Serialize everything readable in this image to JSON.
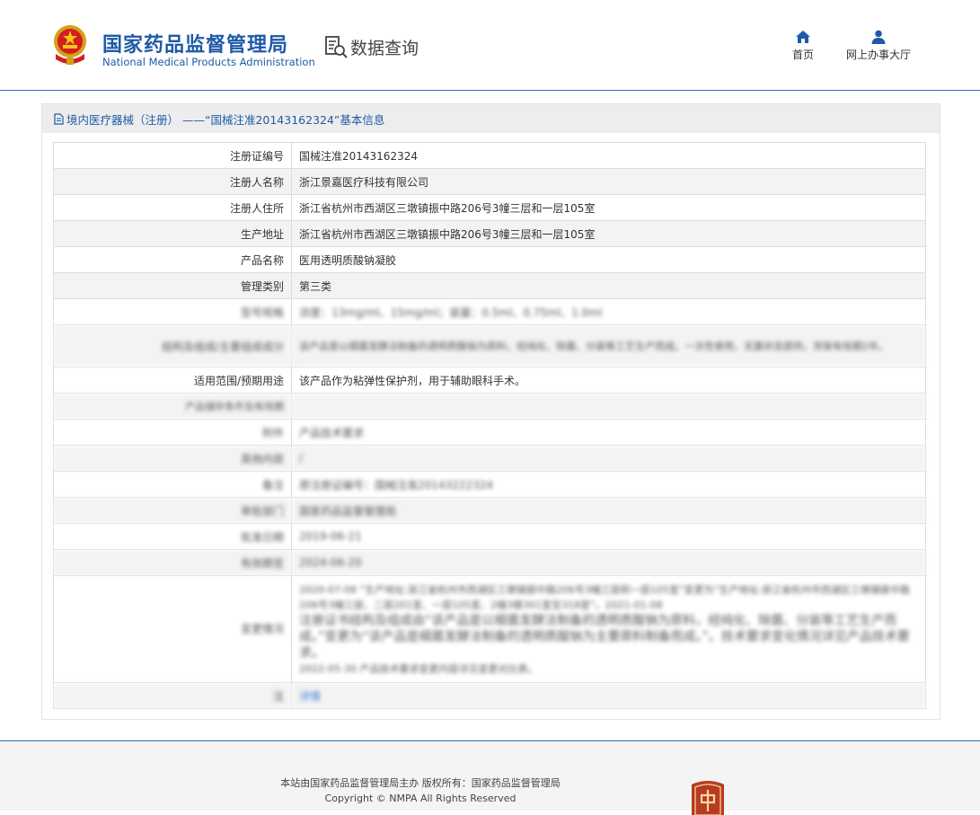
{
  "header": {
    "brand_cn": "国家药品监督管理局",
    "brand_en": "National Medical Products Administration",
    "data_query": "数据查询",
    "nav": [
      {
        "label": "首页",
        "icon": "home-icon"
      },
      {
        "label": "网上办事大厅",
        "icon": "user-icon"
      }
    ]
  },
  "panel": {
    "title": "境内医疗器械（注册） ——“国械注准20143162324”基本信息"
  },
  "rows": [
    {
      "key": "注册证编号",
      "value": "国械注准20143162324"
    },
    {
      "key": "注册人名称",
      "value": "浙江景嘉医疗科技有限公司"
    },
    {
      "key": "注册人住所",
      "value": "浙江省杭州市西湖区三墩镇振中路206号3幢三层和一层105室"
    },
    {
      "key": "生产地址",
      "value": "浙江省杭州市西湖区三墩镇振中路206号3幢三层和一层105室"
    },
    {
      "key": "产品名称",
      "value": "医用透明质酸钠凝胶"
    },
    {
      "key": "管理类别",
      "value": "第三类"
    },
    {
      "key": "型号规格",
      "value": "浓度：13mg/ml、15mg/ml；装量：0.5ml、0.75ml、1.0ml"
    },
    {
      "key": "结构及组成/主要组成成分",
      "value": "该产品是以细菌发酵法制备的透明质酸钠为原料，经纯化、除菌、分装等工艺生产而成。一次性使用，无菌状态提供。货架有效期2年。"
    },
    {
      "key": "适用范围/预期用途",
      "value": "该产品作为粘弹性保护剂，用于辅助眼科手术。"
    },
    {
      "key": "产品储存条件及有效期",
      "value": ""
    },
    {
      "key": "附件",
      "value": "产品技术要求"
    },
    {
      "key": "其他内容",
      "value": "/"
    },
    {
      "key": "备注",
      "value": "原注册证编号：国械注准20143222324"
    },
    {
      "key": "审批部门",
      "value": "国家药品监督管理局"
    },
    {
      "key": "批准日期",
      "value": "2019-06-21"
    },
    {
      "key": "有效期至",
      "value": "2024-06-20"
    },
    {
      "key": "变更情况",
      "lines": [
        "2020-07-08 “生产地址:浙江省杭州市西湖区三墩镇振中路206号3幢三层和一层105室”变更为“生产地址:浙江省杭州市西湖区三墩镇振中路206号3幢三层、二层201室、一层105室、2幢3楼301室至318室”。2021-01-08",
        "注册证书结构及组成由“该产品是以细菌发酵法制备的透明质酸钠为原料，经纯化、除菌、分装等工艺生产而成。”变更为“该产品是细菌发酵法制备的透明质酸钠为主要原料制备而成。”。技术要求变化情况详见产品技术要求。",
        "2022-05-30 产品技术要求变更内容详见变更对比表。"
      ]
    },
    {
      "key": "注",
      "value": "详情"
    }
  ],
  "footer": {
    "line1": "本站由国家药品监督管理局主办 版权所有：国家药品监督管理局",
    "line2": "Copyright © NMPA All Rights Reserved"
  }
}
